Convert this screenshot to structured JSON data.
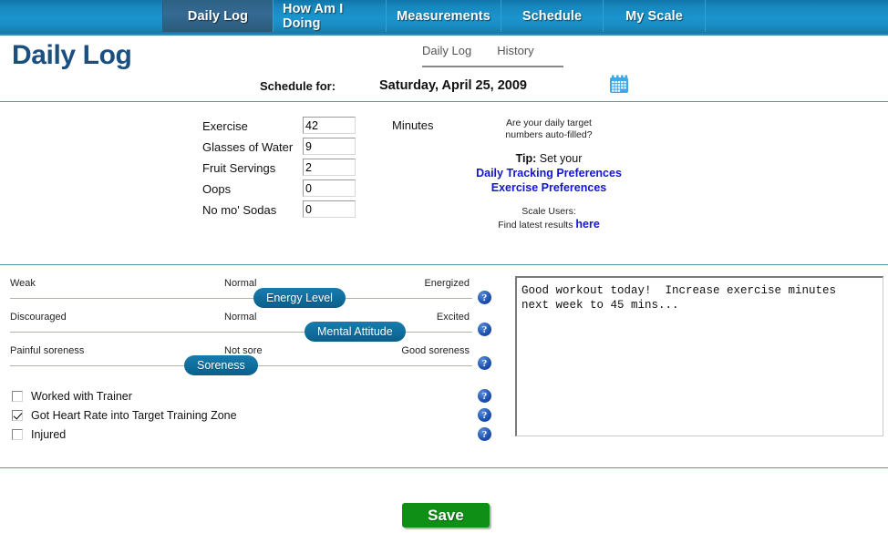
{
  "nav": {
    "tabs": [
      {
        "label": "Daily Log",
        "active": true
      },
      {
        "label": "How Am I Doing",
        "active": false
      },
      {
        "label": "Measurements",
        "active": false
      },
      {
        "label": "Schedule",
        "active": false
      },
      {
        "label": "My Scale",
        "active": false
      }
    ]
  },
  "header": {
    "title": "Daily Log",
    "subtabs": [
      {
        "label": "Daily Log"
      },
      {
        "label": "History"
      }
    ],
    "schedule_label": "Schedule for:",
    "schedule_date": "Saturday, April 25, 2009",
    "calendar_icon": "calendar-icon"
  },
  "fields": {
    "unit_label": "Minutes",
    "rows": [
      {
        "label": "Exercise",
        "value": "42"
      },
      {
        "label": "Glasses of Water",
        "value": "9"
      },
      {
        "label": "Fruit Servings",
        "value": "2"
      },
      {
        "label": "Oops",
        "value": "0"
      },
      {
        "label": "No mo' Sodas",
        "value": "0"
      }
    ]
  },
  "tips": {
    "question_line1": "Are your daily target",
    "question_line2": "numbers auto-filled?",
    "tip_bold": "Tip:",
    "tip_rest": " Set your",
    "link1": "Daily Tracking Preferences",
    "link2": "Exercise Preferences",
    "scale_line1": "Scale Users:",
    "scale_line2": "Find latest results",
    "scale_link": "here",
    "link_color": "#1414d2"
  },
  "sliders": [
    {
      "name": "Energy Level",
      "low": "Weak",
      "mid": "Normal",
      "high": "Energized",
      "position_pct": 62,
      "help_icon": "help-icon"
    },
    {
      "name": "Mental Attitude",
      "low": "Discouraged",
      "mid": "Normal",
      "high": "Excited",
      "position_pct": 80,
      "help_icon": "help-icon"
    },
    {
      "name": "Soreness",
      "low": "Painful soreness",
      "mid": "Not sore",
      "high": "Good soreness",
      "position_pct": 48,
      "help_icon": "help-icon"
    }
  ],
  "checkboxes": [
    {
      "label": "Worked with Trainer",
      "checked": false,
      "help_icon": "help-icon"
    },
    {
      "label": "Got Heart Rate into Target Training Zone",
      "checked": true,
      "help_icon": "help-icon"
    },
    {
      "label": "Injured",
      "checked": false,
      "help_icon": "help-icon"
    }
  ],
  "notes": {
    "value": "Good workout today!  Increase exercise minutes\nnext week to 45 mins...",
    "placeholder": ""
  },
  "footer": {
    "save_label": "Save",
    "save_color": "#0f8f15"
  }
}
